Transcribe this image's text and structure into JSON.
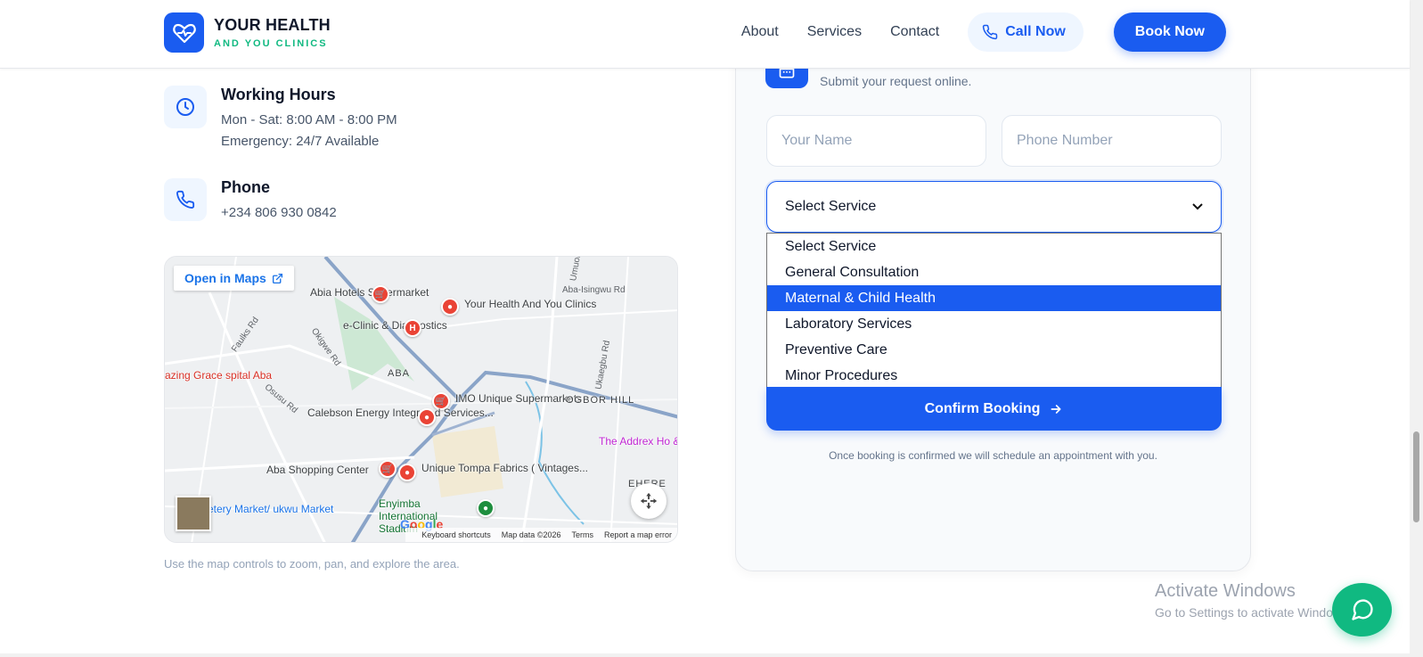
{
  "header": {
    "logo_title": "YOUR HEALTH",
    "logo_subtitle": "AND YOU CLINICS",
    "nav": [
      "About",
      "Services",
      "Contact"
    ],
    "call_label": "Call Now",
    "book_label": "Book Now"
  },
  "contact": {
    "hours_title": "Working Hours",
    "hours_lines": [
      "Mon - Sat: 8:00 AM - 8:00 PM",
      "Emergency: 24/7 Available"
    ],
    "phone_title": "Phone",
    "phone_number": "+234 806 930 0842"
  },
  "map": {
    "open_label": "Open in Maps",
    "places": [
      "Abia Hotels Supermarket",
      "e-Clinic & Diagnostics",
      "Your Health And You Clinics",
      "azing Grace spital Aba",
      "ABA",
      "IMO Unique Supermarkets",
      "Calebson Energy Integrated Services...",
      "OGBOR HILL",
      "The Addrex Ho & Suites A",
      "Aba Shopping Center",
      "Unique Tompa Fabrics ( Vintages...",
      "EHERE",
      "etery Market/ ukwu Market",
      "Enyimba International Stadium"
    ],
    "roads": [
      "Aba-Isingwu Rd",
      "Umuohia",
      "Faulks Rd",
      "Okigwe Rd",
      "Osusu Rd",
      "Ukaegbu Rd"
    ],
    "attribution": [
      "Keyboard shortcuts",
      "Map data ©2026",
      "Terms",
      "Report a map error"
    ],
    "google": "Google",
    "note": "Use the map controls to zoom, pan, and explore the area."
  },
  "booking": {
    "subtitle": "Submit your request online.",
    "name_placeholder": "Your Name",
    "phone_placeholder": "Phone Number",
    "select_value": "Select Service",
    "options": [
      "Select Service",
      "General Consultation",
      "Maternal & Child Health",
      "Laboratory Services",
      "Preventive Care",
      "Minor Procedures"
    ],
    "highlighted_option": "Maternal & Child Health",
    "confirm_label": "Confirm Booking",
    "note": "Once booking is confirmed we will schedule an appointment with you."
  },
  "watermark": {
    "title": "Activate Windows",
    "subtitle": "Go to Settings to activate Windows."
  },
  "colors": {
    "primary": "#1a5cf0",
    "accent_green": "#10b981",
    "text_dark": "#0f172a",
    "text_muted": "#64748b"
  }
}
